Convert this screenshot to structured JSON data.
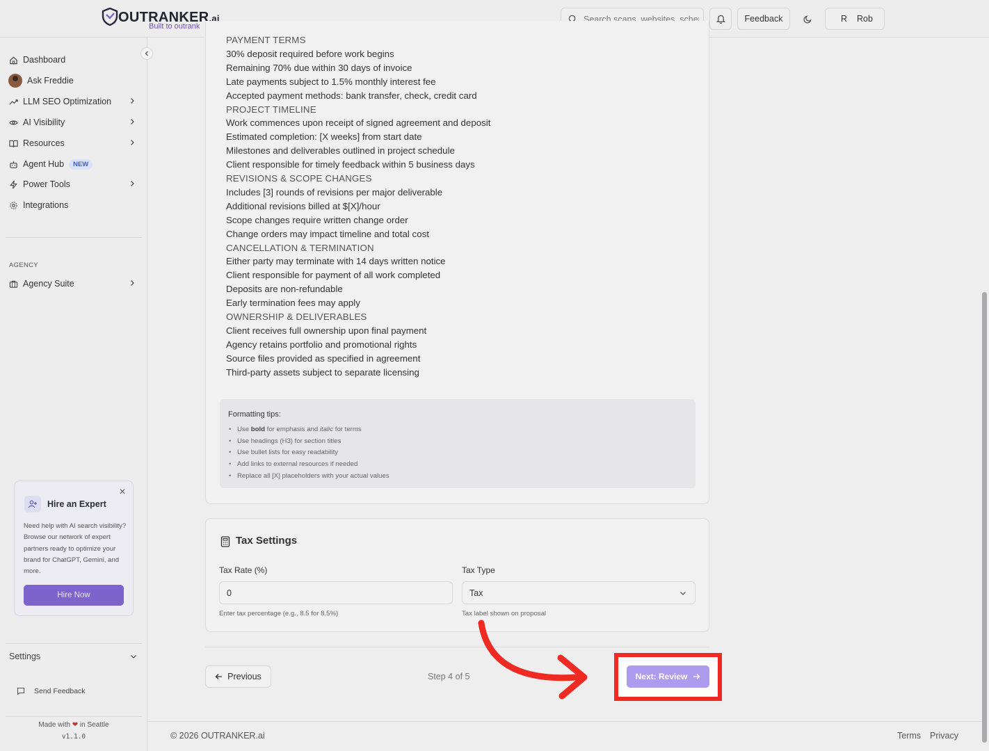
{
  "header": {
    "logo_text": "OUTRANKER",
    "logo_suffix": ".ai",
    "logo_tagline": "Built to outrank",
    "search_placeholder": "Search scans, websites, schemas...",
    "feedback_label": "Feedback",
    "user_initial": "R",
    "user_name": "Rob"
  },
  "sidebar": {
    "items": [
      {
        "label": "Dashboard",
        "icon": "home-icon"
      },
      {
        "label": "Ask Freddie",
        "icon": "avatar"
      },
      {
        "label": "LLM SEO Optimization",
        "icon": "trending-up-icon",
        "chevron": true
      },
      {
        "label": "AI Visibility",
        "icon": "eye-icon",
        "chevron": true
      },
      {
        "label": "Resources",
        "icon": "book-icon",
        "chevron": true
      },
      {
        "label": "Agent Hub",
        "icon": "bot-icon",
        "badge": "NEW"
      },
      {
        "label": "Power Tools",
        "icon": "zap-icon",
        "chevron": true
      },
      {
        "label": "Integrations",
        "icon": "gear-icon"
      }
    ],
    "section_label": "AGENCY",
    "agency_item": "Agency Suite",
    "expert_card": {
      "title": "Hire an Expert",
      "description": "Need help with AI search visibility? Browse our network of expert partners ready to optimize your brand for ChatGPT, Gemini, and more.",
      "button": "Hire Now"
    },
    "settings_label": "Settings",
    "send_feedback": "Send Feedback",
    "made_with_prefix": "Made with",
    "made_with_suffix": "in Seattle",
    "version": "v1.1.0"
  },
  "terms": {
    "lines": [
      {
        "text": "PAYMENT TERMS",
        "head": true
      },
      {
        "text": "30% deposit required before work begins"
      },
      {
        "text": "Remaining 70% due within 30 days of invoice"
      },
      {
        "text": "Late payments subject to 1.5% monthly interest fee"
      },
      {
        "text": "Accepted payment methods: bank transfer, check, credit card"
      },
      {
        "text": "PROJECT TIMELINE",
        "head": true
      },
      {
        "text": "Work commences upon receipt of signed agreement and deposit"
      },
      {
        "text": "Estimated completion: [X weeks] from start date"
      },
      {
        "text": "Milestones and deliverables outlined in project schedule"
      },
      {
        "text": "Client responsible for timely feedback within 5 business days"
      },
      {
        "text": "REVISIONS & SCOPE CHANGES",
        "head": true
      },
      {
        "text": "Includes [3] rounds of revisions per major deliverable"
      },
      {
        "text": "Additional revisions billed at $[X]/hour"
      },
      {
        "text": "Scope changes require written change order"
      },
      {
        "text": "Change orders may impact timeline and total cost"
      },
      {
        "text": "CANCELLATION & TERMINATION",
        "head": true
      },
      {
        "text": "Either party may terminate with 14 days written notice"
      },
      {
        "text": "Client responsible for payment of all work completed"
      },
      {
        "text": "Deposits are non-refundable"
      },
      {
        "text": "Early termination fees may apply"
      },
      {
        "text": "OWNERSHIP & DELIVERABLES",
        "head": true
      },
      {
        "text": "Client receives full ownership upon final payment"
      },
      {
        "text": "Agency retains portfolio and promotional rights"
      },
      {
        "text": "Source files provided as specified in agreement"
      },
      {
        "text": "Third-party assets subject to separate licensing"
      }
    ],
    "tips_title": "Formatting tips:",
    "tips": [
      "Use bold for emphasis and italic for terms",
      "Use headings (H3) for section titles",
      "Use bullet lists for easy readability",
      "Add links to external resources if needed",
      "Replace all [X] placeholders with your actual values"
    ]
  },
  "tax": {
    "title": "Tax Settings",
    "rate_label": "Tax Rate (%)",
    "rate_value": "0",
    "rate_hint": "Enter tax percentage (e.g., 8.5 for 8.5%)",
    "type_label": "Tax Type",
    "type_value": "Tax",
    "type_hint": "Tax label shown on proposal"
  },
  "nav": {
    "previous": "Previous",
    "step": "Step 4 of 5",
    "next": "Next: Review"
  },
  "footer": {
    "copyright": "© 2026 OUTRANKER.ai",
    "terms": "Terms",
    "privacy": "Privacy"
  },
  "colors": {
    "accent": "#7d64cd",
    "next_button": "#ad9bf0",
    "highlight": "#ee2a22"
  }
}
